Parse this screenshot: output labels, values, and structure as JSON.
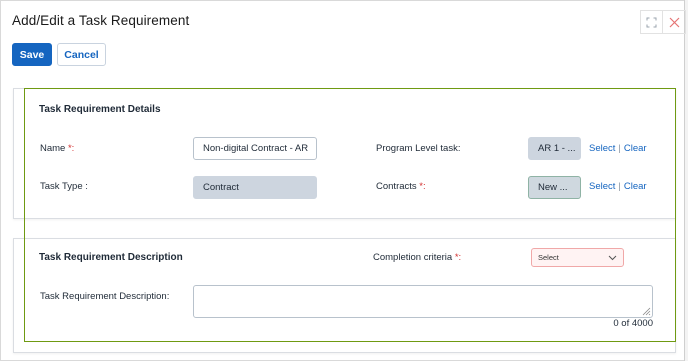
{
  "dialog": {
    "title": "Add/Edit a Task Requirement",
    "icons": {
      "maximize": "maximize-icon",
      "close": "close-icon"
    }
  },
  "actions": {
    "save_label": "Save",
    "cancel_label": "Cancel"
  },
  "details": {
    "section_title": "Task Requirement Details",
    "name_label": "Name",
    "name_required": "*:",
    "name_value": "Non-digital Contract - AR",
    "task_type_label": "Task Type :",
    "task_type_value": "Contract",
    "program_task_label": "Program Level task:",
    "program_task_value": "AR 1 - ...",
    "contracts_label": "Contracts",
    "contracts_required": "*:",
    "contracts_value": "New   ...",
    "select_link": "Select",
    "separator": "|",
    "clear_link": "Clear"
  },
  "description": {
    "section_title": "Task Requirement Description",
    "completion_label": "Completion criteria",
    "completion_required": "*:",
    "completion_select_value": "Select",
    "field_label": "Task Requirement Description:",
    "field_value": "",
    "char_count": "0 of 4000"
  },
  "colors": {
    "primary": "#1565c0",
    "required": "#d32f2f",
    "highlight_border": "#6f9a12",
    "disabled_field": "#cdd5df",
    "error_select_bg": "#fff3f3"
  }
}
